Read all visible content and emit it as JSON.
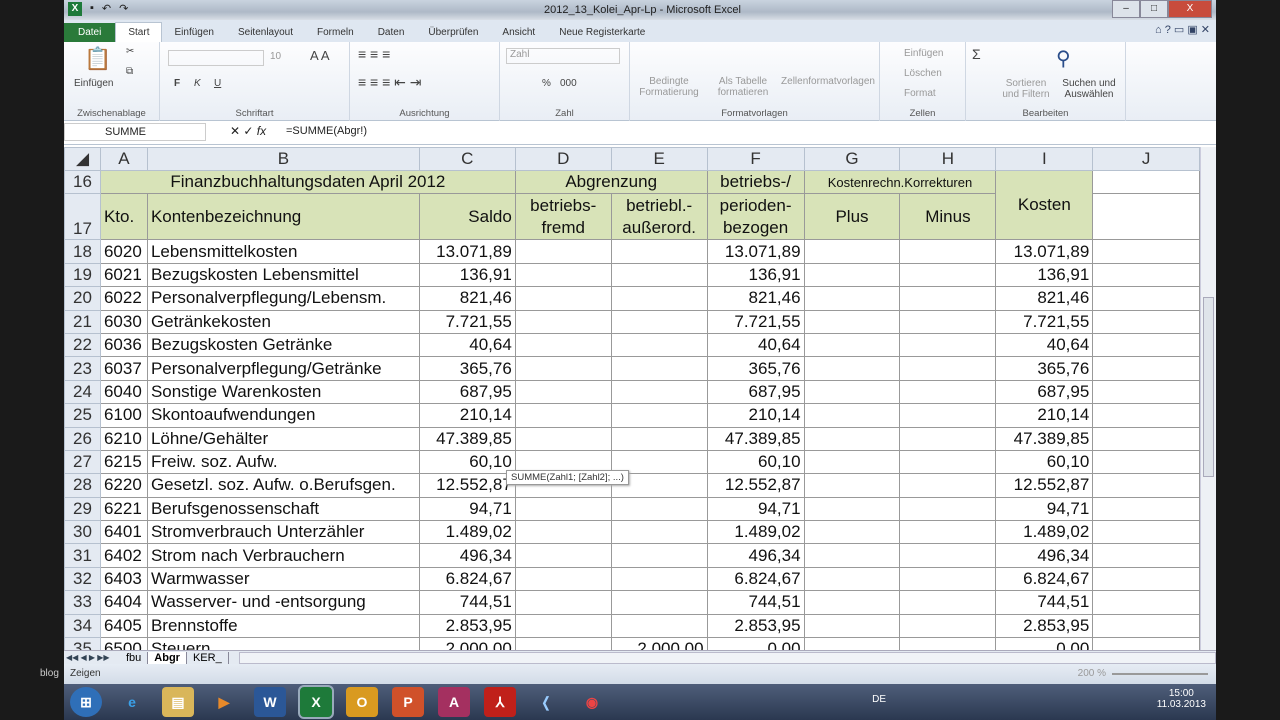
{
  "window": {
    "title": "2012_13_Kolei_Apr-Lp - Microsoft Excel",
    "minimize": "–",
    "maximize": "□",
    "close": "X"
  },
  "ribbon_tabs": [
    "Datei",
    "Start",
    "Einfügen",
    "Seitenlayout",
    "Formeln",
    "Daten",
    "Überprüfen",
    "Ansicht",
    "Neue Registerkarte"
  ],
  "ribbon": {
    "clipboard": {
      "label": "Zwischenablage",
      "paste": "Einfügen"
    },
    "font": {
      "label": "Schriftart",
      "size": "10",
      "bold": "F",
      "italic": "K",
      "underline": "U"
    },
    "alignment": {
      "label": "Ausrichtung"
    },
    "number": {
      "label": "Zahl",
      "format": "Zahl",
      "percent": "%",
      "thousands": "000"
    },
    "styles": {
      "label": "Formatvorlagen",
      "conditional": "Bedingte Formatierung",
      "table": "Als Tabelle formatieren",
      "cell": "Zellenformatvorlagen"
    },
    "cells": {
      "label": "Zellen",
      "insert": "Einfügen",
      "delete": "Löschen",
      "format": "Format"
    },
    "editing": {
      "label": "Bearbeiten",
      "sum": "Σ",
      "sort": "Sortieren und Filtern",
      "find": "Suchen und Auswählen"
    }
  },
  "formula_bar": {
    "name_box": "SUMME",
    "formula": "=SUMME(Abgr!)",
    "fx": "fx"
  },
  "tooltip": "SUMME(Zahl1; [Zahl2]; ...)",
  "columns": [
    "A",
    "B",
    "C",
    "D",
    "E",
    "F",
    "G",
    "H",
    "I",
    "J"
  ],
  "header": {
    "r16": {
      "num": "16",
      "fibu": "Finanzbuchhaltungsdaten April 2012",
      "abgr": "Abgrenzung",
      "betr": "betriebs-/",
      "korr": "Kostenrechn.Korrekturen"
    },
    "r17": {
      "num": "17",
      "kto": "Kto.",
      "bez": "Kontenbezeichnung",
      "saldo": "Saldo",
      "fremd": "betriebs-\nfremd",
      "ausser": "betriebl.-\naußerord.",
      "perioden": "perioden-\nbezogen",
      "plus": "Plus",
      "minus": "Minus",
      "kosten": "Kosten"
    }
  },
  "rows": [
    [
      "18",
      "6020",
      "Lebensmittelkosten",
      "13.071,89",
      "",
      "",
      "13.071,89",
      "13.071,89"
    ],
    [
      "19",
      "6021",
      "Bezugskosten Lebensmittel",
      "136,91",
      "",
      "",
      "136,91",
      "136,91"
    ],
    [
      "20",
      "6022",
      "Personalverpflegung/Lebensm.",
      "821,46",
      "",
      "",
      "821,46",
      "821,46"
    ],
    [
      "21",
      "6030",
      "Getränkekosten",
      "7.721,55",
      "",
      "",
      "7.721,55",
      "7.721,55"
    ],
    [
      "22",
      "6036",
      "Bezugskosten Getränke",
      "40,64",
      "",
      "",
      "40,64",
      "40,64"
    ],
    [
      "23",
      "6037",
      "Personalverpflegung/Getränke",
      "365,76",
      "",
      "",
      "365,76",
      "365,76"
    ],
    [
      "24",
      "6040",
      "Sonstige Warenkosten",
      "687,95",
      "",
      "",
      "687,95",
      "687,95"
    ],
    [
      "25",
      "6100",
      "Skontoaufwendungen",
      "210,14",
      "",
      "",
      "210,14",
      "210,14"
    ],
    [
      "26",
      "6210",
      "Löhne/Gehälter",
      "47.389,85",
      "",
      "",
      "47.389,85",
      "47.389,85"
    ],
    [
      "27",
      "6215",
      "Freiw. soz. Aufw.",
      "60,10",
      "",
      "",
      "60,10",
      "60,10"
    ],
    [
      "28",
      "6220",
      "Gesetzl. soz. Aufw. o.Berufsgen.",
      "12.552,87",
      "",
      "",
      "12.552,87",
      "12.552,87"
    ],
    [
      "29",
      "6221",
      "Berufsgenossenschaft",
      "94,71",
      "",
      "",
      "94,71",
      "94,71"
    ],
    [
      "30",
      "6401",
      "Stromverbrauch Unterzähler",
      "1.489,02",
      "",
      "",
      "1.489,02",
      "1.489,02"
    ],
    [
      "31",
      "6402",
      "Strom nach Verbrauchern",
      "496,34",
      "",
      "",
      "496,34",
      "496,34"
    ],
    [
      "32",
      "6403",
      "Warmwasser",
      "6.824,67",
      "",
      "",
      "6.824,67",
      "6.824,67"
    ],
    [
      "33",
      "6404",
      "Wasserver- und -entsorgung",
      "744,51",
      "",
      "",
      "744,51",
      "744,51"
    ],
    [
      "34",
      "6405",
      "Brennstoffe",
      "2.853,95",
      "",
      "",
      "2.853,95",
      "2.853,95"
    ],
    [
      "35",
      "6500",
      "Steuern",
      "2.000,00",
      "",
      "2.000,00",
      "0,00",
      "0,00"
    ]
  ],
  "sheet_tabs": [
    "fbu",
    "Abgr",
    "KER_"
  ],
  "active_sheet": "Abgr",
  "status": {
    "mode": "Zeigen",
    "zoom": "200 %"
  },
  "taskbar": {
    "lang": "DE",
    "time": "15:00",
    "date": "11.03.2013",
    "apps": [
      "start",
      "internet-explorer",
      "explorer",
      "media-player",
      "word",
      "excel",
      "outlook",
      "powerpoint",
      "access",
      "acrobat",
      "app",
      "chrome"
    ]
  },
  "watermark": "blog",
  "colors": {
    "header_fill": "#d8e3b8",
    "file_tab": "#2a7a3a"
  }
}
